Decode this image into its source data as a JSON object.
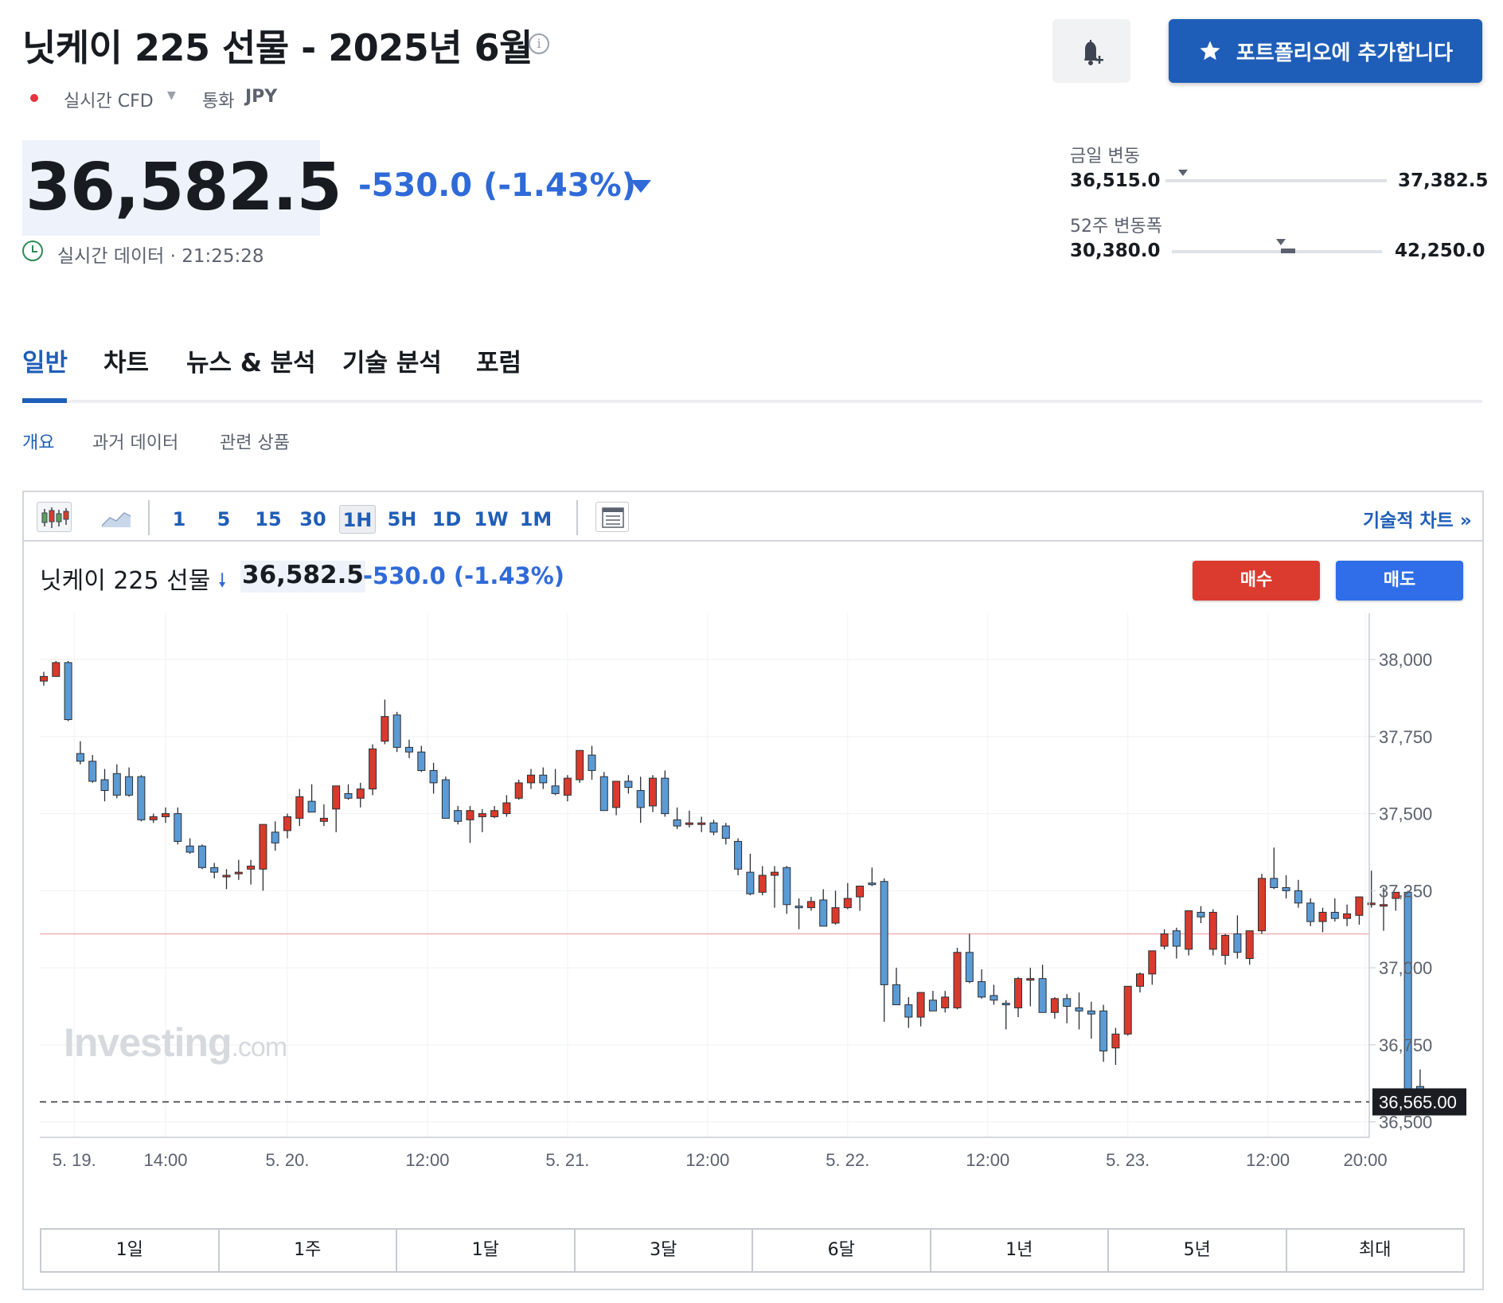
{
  "header": {
    "title": "닛케이 225 선물 - 2025년 6월",
    "source_label": "실시간 CFD",
    "currency_label": "통화",
    "currency_value": "JPY",
    "portfolio_button_label": "포트폴리오에 추가합니다"
  },
  "quote": {
    "price": "36,582.5",
    "change": "-530.0  (-1.43%)",
    "realtime_text": "실시간 데이터 · 21:25:28"
  },
  "ranges": {
    "day": {
      "title": "금일 변동",
      "low": "36,515.0",
      "high": "37,382.5",
      "current_fraction": 0.08
    },
    "week52": {
      "title": "52주 변동폭",
      "low": "30,380.0",
      "high": "42,250.0",
      "current_fraction": 0.52
    }
  },
  "tabs": [
    "일반",
    "차트",
    "뉴스 & 분석",
    "기술 분석",
    "포럼"
  ],
  "subtabs": [
    "개요",
    "과거 데이터",
    "관련 상품"
  ],
  "toolbar": {
    "timeframes": [
      "1",
      "5",
      "15",
      "30",
      "1H",
      "5H",
      "1D",
      "1W",
      "1M"
    ],
    "selected": "1H",
    "tech_chart_link": "기술적 차트 »"
  },
  "chart_header": {
    "name": "닛케이 225 선물",
    "price": "36,582.5",
    "change": "-530.0  (-1.43%)",
    "buy_label": "매수",
    "sell_label": "매도"
  },
  "watermark": {
    "brand": "Investing",
    "suffix": ".com"
  },
  "periods": [
    "1일",
    "1주",
    "1달",
    "3달",
    "6달",
    "1년",
    "5년",
    "최대"
  ],
  "colors": {
    "up": "#d93a2b",
    "down": "#5b9bd5",
    "accent": "#1f5eb8",
    "price_blue": "#2f6ad8"
  },
  "chart_data": {
    "type": "candlestick",
    "ylim": [
      36450,
      38150
    ],
    "y_ticks": [
      38000,
      37750,
      37500,
      37250,
      37000,
      36750,
      36500
    ],
    "y_tick_labels": [
      "38,000",
      "37,750",
      "37,500",
      "37,250",
      "37,000",
      "36,750",
      "36,500"
    ],
    "x_tick_labels": [
      "5. 19.",
      "14:00",
      "5. 20.",
      "12:00",
      "5. 21.",
      "12:00",
      "5. 22.",
      "12:00",
      "5. 23.",
      "12:00",
      "20:00"
    ],
    "x_tick_index": [
      2.5,
      10,
      20,
      31.5,
      43,
      54.5,
      66,
      77.5,
      89,
      100.5,
      108.5
    ],
    "reference_line": 37110,
    "last_price_label": "36,565.00",
    "last_price": 36565,
    "candles": [
      [
        37930,
        37960,
        37915,
        37945
      ],
      [
        37945,
        37995,
        37945,
        37990
      ],
      [
        37990,
        37995,
        37800,
        37805
      ],
      [
        37695,
        37735,
        37660,
        37670
      ],
      [
        37670,
        37690,
        37600,
        37605
      ],
      [
        37610,
        37645,
        37540,
        37575
      ],
      [
        37630,
        37660,
        37550,
        37560
      ],
      [
        37620,
        37650,
        37555,
        37560
      ],
      [
        37620,
        37625,
        37475,
        37480
      ],
      [
        37480,
        37500,
        37470,
        37490
      ],
      [
        37490,
        37520,
        37470,
        37500
      ],
      [
        37500,
        37520,
        37400,
        37410
      ],
      [
        37395,
        37420,
        37370,
        37375
      ],
      [
        37395,
        37400,
        37320,
        37325
      ],
      [
        37325,
        37340,
        37290,
        37310
      ],
      [
        37300,
        37320,
        37255,
        37300
      ],
      [
        37310,
        37350,
        37285,
        37310
      ],
      [
        37320,
        37350,
        37270,
        37330
      ],
      [
        37320,
        37430,
        37250,
        37465
      ],
      [
        37440,
        37475,
        37380,
        37405
      ],
      [
        37445,
        37500,
        37420,
        37490
      ],
      [
        37485,
        37580,
        37460,
        37555
      ],
      [
        37540,
        37595,
        37510,
        37505
      ],
      [
        37475,
        37530,
        37460,
        37485
      ],
      [
        37515,
        37590,
        37440,
        37590
      ],
      [
        37565,
        37595,
        37545,
        37550
      ],
      [
        37550,
        37600,
        37520,
        37580
      ],
      [
        37580,
        37725,
        37560,
        37710
      ],
      [
        37735,
        37870,
        37725,
        37815
      ],
      [
        37820,
        37830,
        37700,
        37715
      ],
      [
        37715,
        37740,
        37680,
        37700
      ],
      [
        37700,
        37720,
        37635,
        37640
      ],
      [
        37640,
        37665,
        37565,
        37600
      ],
      [
        37610,
        37620,
        37485,
        37485
      ],
      [
        37510,
        37525,
        37465,
        37475
      ],
      [
        37480,
        37525,
        37405,
        37510
      ],
      [
        37490,
        37515,
        37440,
        37500
      ],
      [
        37490,
        37525,
        37485,
        37510
      ],
      [
        37500,
        37560,
        37490,
        37535
      ],
      [
        37550,
        37610,
        37545,
        37600
      ],
      [
        37600,
        37645,
        37580,
        37625
      ],
      [
        37625,
        37650,
        37580,
        37600
      ],
      [
        37590,
        37645,
        37560,
        37565
      ],
      [
        37560,
        37625,
        37540,
        37615
      ],
      [
        37610,
        37700,
        37600,
        37705
      ],
      [
        37690,
        37720,
        37610,
        37640
      ],
      [
        37620,
        37635,
        37510,
        37510
      ],
      [
        37520,
        37600,
        37495,
        37605
      ],
      [
        37605,
        37625,
        37565,
        37585
      ],
      [
        37575,
        37620,
        37470,
        37520
      ],
      [
        37525,
        37625,
        37505,
        37615
      ],
      [
        37615,
        37640,
        37490,
        37500
      ],
      [
        37480,
        37520,
        37450,
        37460
      ],
      [
        37470,
        37510,
        37455,
        37470
      ],
      [
        37465,
        37490,
        37440,
        37470
      ],
      [
        37470,
        37480,
        37430,
        37440
      ],
      [
        37460,
        37470,
        37400,
        37420
      ],
      [
        37410,
        37420,
        37300,
        37320
      ],
      [
        37310,
        37370,
        37235,
        37240
      ],
      [
        37245,
        37330,
        37235,
        37300
      ],
      [
        37300,
        37330,
        37195,
        37310
      ],
      [
        37325,
        37330,
        37175,
        37205
      ],
      [
        37200,
        37225,
        37125,
        37195
      ],
      [
        37195,
        37230,
        37185,
        37215
      ],
      [
        37220,
        37255,
        37140,
        37135
      ],
      [
        37145,
        37250,
        37140,
        37195
      ],
      [
        37195,
        37275,
        37190,
        37225
      ],
      [
        37230,
        37260,
        37185,
        37265
      ],
      [
        37275,
        37325,
        37265,
        37270
      ],
      [
        37280,
        37290,
        36825,
        36945
      ],
      [
        36945,
        37000,
        36890,
        36880
      ],
      [
        36880,
        36905,
        36805,
        36840
      ],
      [
        36840,
        36900,
        36810,
        36920
      ],
      [
        36895,
        36925,
        36870,
        36860
      ],
      [
        36870,
        36925,
        36855,
        36905
      ],
      [
        36870,
        37065,
        36865,
        37050
      ],
      [
        37050,
        37110,
        36950,
        36955
      ],
      [
        36955,
        36995,
        36900,
        36905
      ],
      [
        36910,
        36945,
        36880,
        36895
      ],
      [
        36885,
        36895,
        36800,
        36880
      ],
      [
        36870,
        36970,
        36840,
        36965
      ],
      [
        36960,
        37000,
        36875,
        36965
      ],
      [
        36965,
        37010,
        36960,
        36855
      ],
      [
        36855,
        36905,
        36835,
        36900
      ],
      [
        36900,
        36915,
        36820,
        36875
      ],
      [
        36870,
        36920,
        36800,
        36860
      ],
      [
        36860,
        36890,
        36770,
        36850
      ],
      [
        36860,
        36880,
        36695,
        36730
      ],
      [
        36740,
        36805,
        36685,
        36785
      ],
      [
        36785,
        36930,
        36780,
        36940
      ],
      [
        36940,
        36985,
        36920,
        36980
      ],
      [
        36980,
        37050,
        36945,
        37055
      ],
      [
        37070,
        37125,
        37060,
        37110
      ],
      [
        37120,
        37130,
        37030,
        37070
      ],
      [
        37060,
        37175,
        37040,
        37185
      ],
      [
        37180,
        37200,
        37145,
        37165
      ],
      [
        37060,
        37190,
        37040,
        37180
      ],
      [
        37040,
        37110,
        37010,
        37105
      ],
      [
        37110,
        37170,
        37030,
        37050
      ],
      [
        37030,
        37120,
        37010,
        37120
      ],
      [
        37120,
        37305,
        37110,
        37290
      ],
      [
        37290,
        37390,
        37255,
        37260
      ],
      [
        37260,
        37300,
        37225,
        37250
      ],
      [
        37250,
        37285,
        37195,
        37210
      ],
      [
        37210,
        37225,
        37135,
        37150
      ],
      [
        37150,
        37195,
        37115,
        37180
      ],
      [
        37180,
        37225,
        37150,
        37160
      ],
      [
        37160,
        37205,
        37135,
        37175
      ],
      [
        37170,
        37195,
        37140,
        37230
      ],
      [
        37210,
        37315,
        37195,
        37210
      ],
      [
        37200,
        37260,
        37120,
        37205
      ],
      [
        37225,
        37235,
        37185,
        37245
      ],
      [
        37245,
        37250,
        36580,
        36590
      ],
      [
        36615,
        36670,
        36545,
        36565
      ]
    ]
  }
}
